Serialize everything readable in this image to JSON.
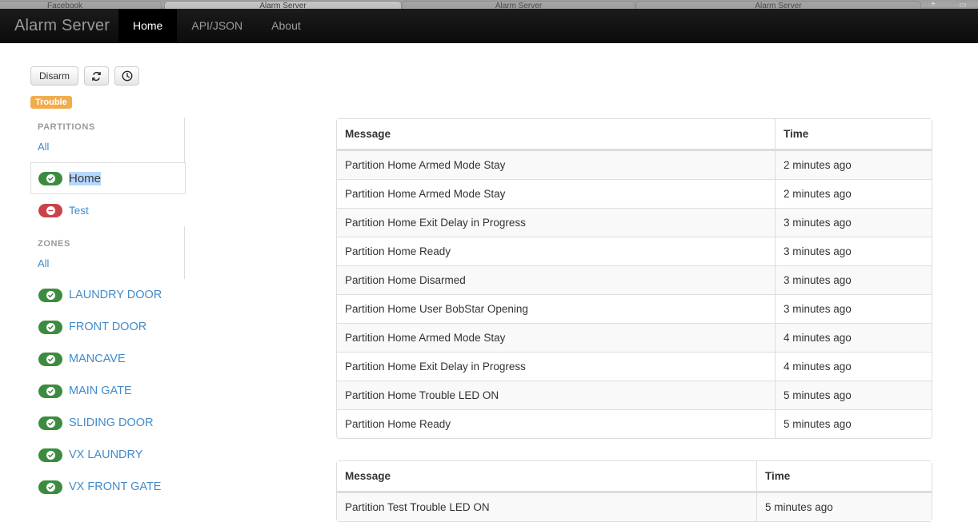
{
  "browser": {
    "tabs": [
      {
        "title": "Facebook",
        "active": false
      },
      {
        "title": "Alarm Server",
        "active": true
      },
      {
        "title": "Alarm Server",
        "active": false
      },
      {
        "title": "Alarm Server",
        "active": false
      }
    ],
    "new_tab_label": "+",
    "window_control_label": "▭"
  },
  "navbar": {
    "brand": "Alarm Server",
    "items": [
      {
        "label": "Home",
        "active": true
      },
      {
        "label": "API/JSON",
        "active": false
      },
      {
        "label": "About",
        "active": false
      }
    ]
  },
  "toolbar": {
    "disarm_label": "Disarm",
    "refresh_icon": "refresh-icon",
    "clock_icon": "clock-icon",
    "status_badge": "Trouble",
    "status_badge_color": "#f0ad4e"
  },
  "sidebar": {
    "partitions": {
      "heading": "PARTITIONS",
      "all_label": "All",
      "items": [
        {
          "label": "Home",
          "state": "ok",
          "selected": true,
          "hovered": true
        },
        {
          "label": "Test",
          "state": "bad",
          "selected": false,
          "hovered": false
        }
      ]
    },
    "zones": {
      "heading": "ZONES",
      "all_label": "All",
      "items": [
        {
          "label": "LAUNDRY DOOR",
          "state": "ok"
        },
        {
          "label": "FRONT DOOR",
          "state": "ok"
        },
        {
          "label": "MANCAVE",
          "state": "ok"
        },
        {
          "label": "MAIN GATE",
          "state": "ok"
        },
        {
          "label": "SLIDING DOOR",
          "state": "ok"
        },
        {
          "label": "VX LAUNDRY",
          "state": "ok"
        },
        {
          "label": "VX FRONT GATE",
          "state": "ok"
        }
      ]
    }
  },
  "tables": [
    {
      "id": "recent",
      "columns": [
        "Message",
        "Time"
      ],
      "rows": [
        [
          "Partition Home Armed Mode Stay",
          "2 minutes ago"
        ],
        [
          "Partition Home Armed Mode Stay",
          "2 minutes ago"
        ],
        [
          "Partition Home Exit Delay in Progress",
          "3 minutes ago"
        ],
        [
          "Partition Home Ready",
          "3 minutes ago"
        ],
        [
          "Partition Home Disarmed",
          "3 minutes ago"
        ],
        [
          "Partition Home User BobStar Opening",
          "3 minutes ago"
        ],
        [
          "Partition Home Armed Mode Stay",
          "4 minutes ago"
        ],
        [
          "Partition Home Exit Delay in Progress",
          "4 minutes ago"
        ],
        [
          "Partition Home Trouble LED ON",
          "5 minutes ago"
        ],
        [
          "Partition Home Ready",
          "5 minutes ago"
        ]
      ]
    },
    {
      "id": "test",
      "columns": [
        "Message",
        "Time"
      ],
      "rows": [
        [
          "Partition Test Trouble LED ON",
          "5 minutes ago"
        ]
      ]
    }
  ],
  "colors": {
    "link": "#428bca",
    "ok": "#3c8c40",
    "bad": "#c9444a",
    "warning": "#f0ad4e",
    "selection": "#b5d6fd"
  }
}
